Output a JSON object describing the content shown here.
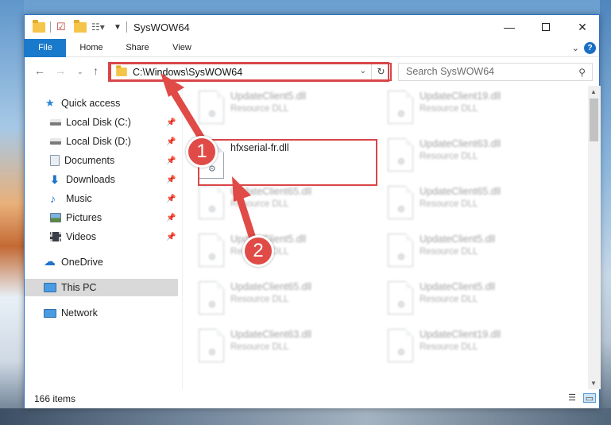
{
  "window": {
    "title": "SysWOW64",
    "minimize_icon": "minimize-icon",
    "maximize_icon": "maximize-icon",
    "close_icon": "close-icon"
  },
  "ribbon": {
    "tabs": [
      {
        "label": "File"
      },
      {
        "label": "Home"
      },
      {
        "label": "Share"
      },
      {
        "label": "View"
      }
    ],
    "help_label": "?"
  },
  "navigation": {
    "address": "C:\\Windows\\SysWOW64",
    "search_placeholder": "Search SysWOW64"
  },
  "sidebar": {
    "items": [
      {
        "label": "Quick access",
        "icon": "star-icon"
      },
      {
        "label": "Local Disk (C:)",
        "icon": "drive-icon",
        "pinned": true
      },
      {
        "label": "Local Disk (D:)",
        "icon": "drive-icon",
        "pinned": true
      },
      {
        "label": "Documents",
        "icon": "documents-icon",
        "pinned": true
      },
      {
        "label": "Downloads",
        "icon": "download-icon",
        "pinned": true
      },
      {
        "label": "Music",
        "icon": "music-icon",
        "pinned": true
      },
      {
        "label": "Pictures",
        "icon": "pictures-icon",
        "pinned": true
      },
      {
        "label": "Videos",
        "icon": "videos-icon",
        "pinned": true
      },
      {
        "label": "OneDrive",
        "icon": "cloud-icon"
      },
      {
        "label": "This PC",
        "icon": "computer-icon",
        "selected": true
      },
      {
        "label": "Network",
        "icon": "network-icon"
      }
    ]
  },
  "files": {
    "highlighted": {
      "name": "hfxserial-fr.dll"
    },
    "left_column": [
      {
        "name": "UpdateClient5.dll",
        "type": "Resource DLL"
      },
      {
        "name": "UpdateClient65.dll",
        "type": "Resource DLL"
      },
      {
        "name": "UpdateClient5.dll",
        "type": "Resource DLL"
      },
      {
        "name": "UpdateClient65.dll",
        "type": "Resource DLL"
      },
      {
        "name": "UpdateClient63.dll",
        "type": "Resource DLL"
      }
    ],
    "right_column": [
      {
        "name": "UpdateClient19.dll",
        "type": "Resource DLL"
      },
      {
        "name": "UpdateClient63.dll",
        "type": "Resource DLL"
      },
      {
        "name": "UpdateClient65.dll",
        "type": "Resource DLL"
      },
      {
        "name": "UpdateClient5.dll",
        "type": "Resource DLL"
      },
      {
        "name": "UpdateClient5.dll",
        "type": "Resource DLL"
      },
      {
        "name": "UpdateClient19.dll",
        "type": "Resource DLL"
      }
    ]
  },
  "status": {
    "item_count": "166 items"
  },
  "callouts": [
    {
      "label": "1"
    },
    {
      "label": "2"
    }
  ],
  "colors": {
    "accent": "#1979ca",
    "highlight_red": "#d94649",
    "callout_red": "#e04a47"
  }
}
